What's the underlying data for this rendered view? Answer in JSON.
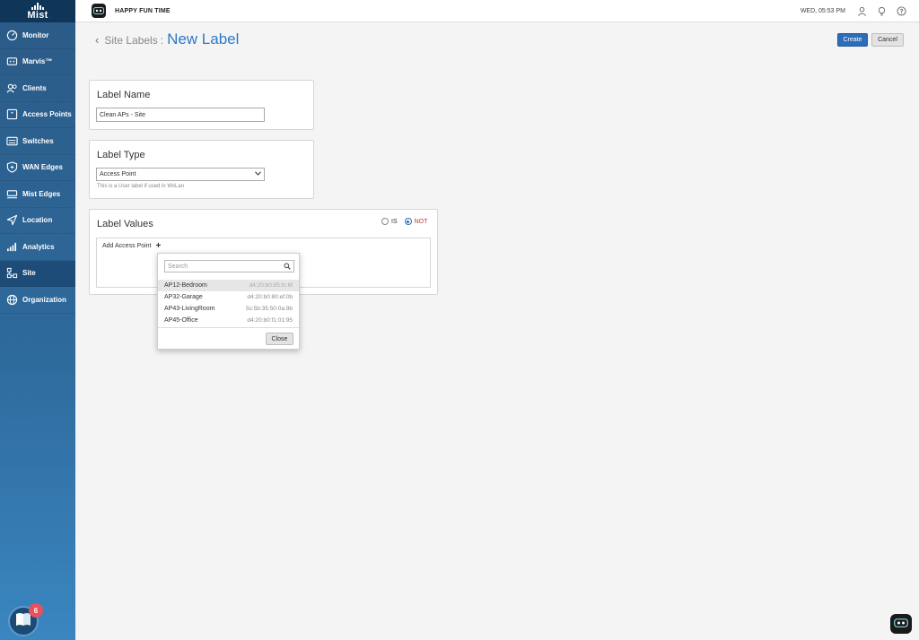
{
  "sidebar": {
    "logo_text": "Mist",
    "items": [
      {
        "label": "Monitor",
        "icon": "monitor-icon"
      },
      {
        "label": "Marvis™",
        "icon": "marvis-icon"
      },
      {
        "label": "Clients",
        "icon": "clients-icon"
      },
      {
        "label": "Access Points",
        "icon": "access-point-icon"
      },
      {
        "label": "Switches",
        "icon": "switch-icon"
      },
      {
        "label": "WAN Edges",
        "icon": "wan-edge-icon"
      },
      {
        "label": "Mist Edges",
        "icon": "mist-edge-icon"
      },
      {
        "label": "Location",
        "icon": "location-icon"
      },
      {
        "label": "Analytics",
        "icon": "analytics-icon"
      },
      {
        "label": "Site",
        "icon": "site-icon",
        "active": true
      },
      {
        "label": "Organization",
        "icon": "organization-icon"
      }
    ],
    "help_badge_count": "6"
  },
  "topbar": {
    "org_name": "HAPPY FUN TIME",
    "datetime": "WED, 05:53 PM"
  },
  "header": {
    "breadcrumb": "Site Labels",
    "separator": ":",
    "title": "New Label",
    "create_label": "Create",
    "cancel_label": "Cancel"
  },
  "label_name": {
    "title": "Label Name",
    "value": "Clean APs - Site"
  },
  "label_type": {
    "title": "Label Type",
    "selected": "Access Point",
    "hint": "This is a User label if used in WxLan"
  },
  "label_values": {
    "title": "Label Values",
    "radio_is": "IS",
    "radio_not": "NOT",
    "selected_mode": "NOT",
    "add_label": "Add Access Point"
  },
  "dropdown": {
    "search_placeholder": "Search",
    "items": [
      {
        "name": "AP12-Bedroom",
        "mac": "d4:20:b0:85:fc:6f"
      },
      {
        "name": "AP32-Garage",
        "mac": "d4:20:b0:80:ef:0b"
      },
      {
        "name": "AP43-LivingRoom",
        "mac": "5c:5b:35:50:0a:9b"
      },
      {
        "name": "AP45-Office",
        "mac": "d4:20:b0:f1:01:95"
      }
    ],
    "close_label": "Close"
  },
  "colors": {
    "accent": "#2d7ac7",
    "primary_button": "#2d6cb8",
    "not_label": "#c0392b",
    "sidebar_top": "#2b5a86",
    "sidebar_bottom": "#3a86c0"
  }
}
